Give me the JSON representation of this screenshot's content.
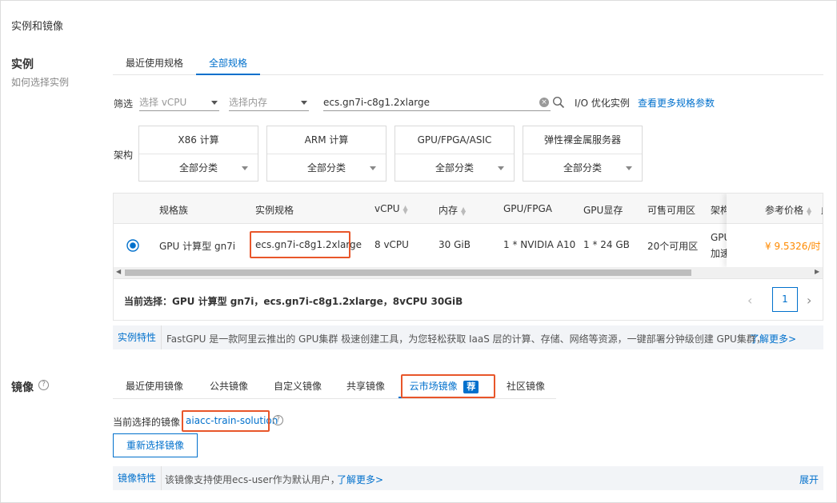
{
  "section_title": "实例和镜像",
  "instance": {
    "label": "实例",
    "help_link": "如何选择实例",
    "tabs": [
      {
        "label": "最近使用规格"
      },
      {
        "label": "全部规格"
      }
    ],
    "filter": {
      "label": "筛选",
      "vcpu_placeholder": "选择 vCPU",
      "memory_placeholder": "选择内存",
      "search_value": "ecs.gn7i-c8g1.2xlarge",
      "io_label": "I/O 优化实例",
      "more_params_link": "查看更多规格参数"
    },
    "arch": {
      "label": "架构",
      "options": [
        {
          "name": "X86 计算",
          "category": "全部分类"
        },
        {
          "name": "ARM 计算",
          "category": "全部分类"
        },
        {
          "name": "GPU/FPGA/ASIC",
          "category": "全部分类"
        },
        {
          "name": "弹性裸金属服务器",
          "category": "全部分类"
        }
      ]
    },
    "table": {
      "headers": {
        "family": "规格族",
        "spec": "实例规格",
        "vcpu": "vCPU",
        "memory": "内存",
        "gpu": "GPU/FPGA",
        "gpu_mem": "GPU显存",
        "zones": "可售可用区",
        "arch": "架构",
        "price": "参考价格",
        "extra": "此"
      },
      "row": {
        "family": "GPU 计算型 gn7i",
        "spec": "ecs.gn7i-c8g1.2xlarge",
        "vcpu": "8 vCPU",
        "memory": "30 GiB",
        "gpu": "1 * NVIDIA A10",
        "gpu_mem": "1 * 24 GB",
        "zones": "20个可用区",
        "arch_line1": "GPU",
        "arch_line2": "加速",
        "price": "¥ 9.5326/时"
      }
    },
    "current_selection": "当前选择：GPU 计算型 gn7i，ecs.gn7i-c8g1.2xlarge，8vCPU 30GiB",
    "pagination": {
      "page": "1"
    },
    "feature": {
      "tag": "实例特性",
      "text": "FastGPU 是一款阿里云推出的 GPU集群 极速创建工具，为您轻松获取 IaaS 层的计算、存储、网络等资源，一键部署分钟级创建 GPU集群，",
      "link": "了解更多>"
    }
  },
  "image": {
    "label": "镜像",
    "tabs": [
      {
        "label": "最近使用镜像"
      },
      {
        "label": "公共镜像"
      },
      {
        "label": "自定义镜像"
      },
      {
        "label": "共享镜像"
      },
      {
        "label": "云市场镜像"
      },
      {
        "label": "社区镜像"
      }
    ],
    "market_badge": "荐",
    "current_label": "当前选择的镜像",
    "current_value": "aiacc-train-solution",
    "reselect_button": "重新选择镜像",
    "feature": {
      "tag": "镜像特性",
      "text": "该镜像支持使用ecs-user作为默认用户，",
      "link": "了解更多>",
      "expand": "展开"
    }
  },
  "colors": {
    "accent": "#0070cc",
    "highlight_box": "#e8562a",
    "price": "#ff8a00"
  }
}
